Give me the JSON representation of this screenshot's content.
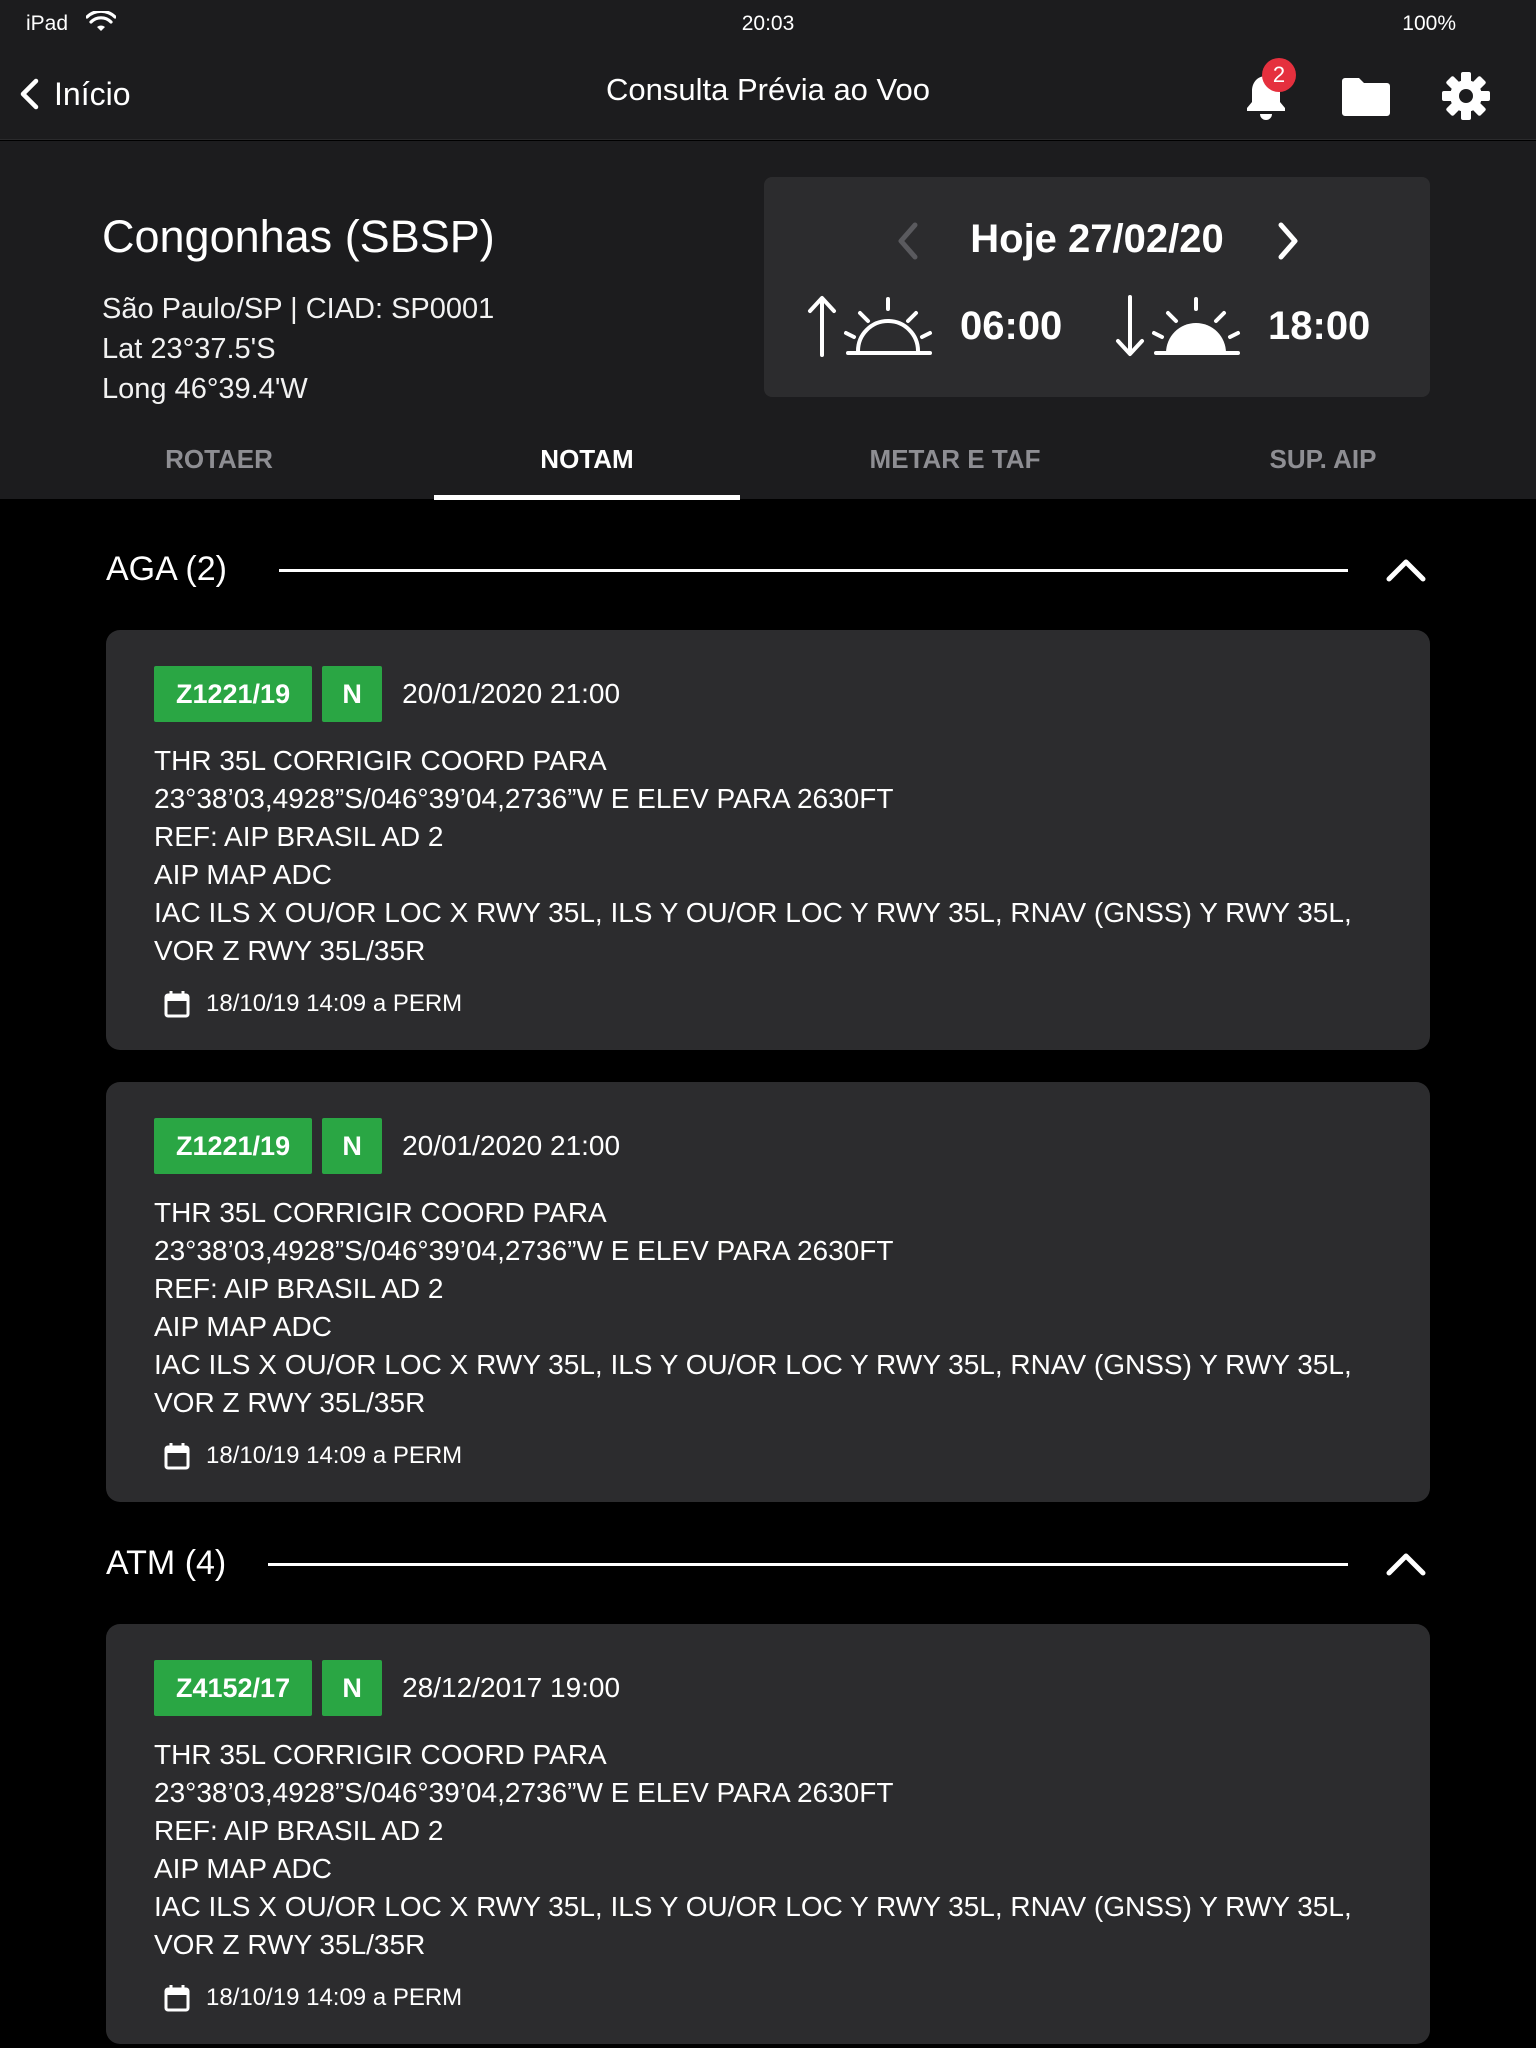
{
  "status_bar": {
    "device": "iPad",
    "time": "20:03",
    "battery": "100%"
  },
  "nav": {
    "back_label": "Início",
    "title": "Consulta Prévia ao Voo",
    "notification_count": "2"
  },
  "airport": {
    "name": "Congonhas (SBSP)",
    "city_ciad": "São Paulo/SP | CIAD: SP0001",
    "lat": "Lat 23°37.5'S",
    "long": "Long 46°39.4'W"
  },
  "date_card": {
    "label": "Hoje 27/02/20",
    "sunrise": "06:00",
    "sunset": "18:00"
  },
  "tabs": [
    {
      "label": "ROTAER"
    },
    {
      "label": "NOTAM"
    },
    {
      "label": "METAR E TAF"
    },
    {
      "label": "SUP. AIP"
    }
  ],
  "sections": [
    {
      "title": "AGA (2)",
      "cards": [
        {
          "id": "Z1221/19",
          "type": "N",
          "date": "20/01/2020 21:00",
          "text": "THR 35L CORRIGIR COORD PARA\n23°38’03,4928”S/046°39’04,2736”W E ELEV PARA 2630FT\nREF: AIP BRASIL AD 2\nAIP MAP ADC\nIAC ILS X OU/OR LOC X RWY 35L, ILS Y OU/OR LOC Y RWY 35L, RNAV (GNSS) Y RWY 35L, VOR Z RWY 35L/35R",
          "validity": "18/10/19 14:09 a PERM"
        },
        {
          "id": "Z1221/19",
          "type": "N",
          "date": "20/01/2020 21:00",
          "text": "THR 35L CORRIGIR COORD PARA\n23°38’03,4928”S/046°39’04,2736”W E ELEV PARA 2630FT\nREF: AIP BRASIL AD 2\nAIP MAP ADC\nIAC ILS X OU/OR LOC X RWY 35L, ILS Y OU/OR LOC Y RWY 35L, RNAV (GNSS) Y RWY 35L, VOR Z RWY 35L/35R",
          "validity": "18/10/19 14:09 a PERM"
        }
      ]
    },
    {
      "title": "ATM (4)",
      "cards": [
        {
          "id": "Z4152/17",
          "type": "N",
          "date": "28/12/2017 19:00",
          "text": "THR 35L CORRIGIR COORD PARA\n23°38’03,4928”S/046°39’04,2736”W E ELEV PARA 2630FT\nREF: AIP BRASIL AD 2\nAIP MAP ADC\nIAC ILS X OU/OR LOC X RWY 35L, ILS Y OU/OR LOC Y RWY 35L, RNAV (GNSS) Y RWY 35L, VOR Z RWY 35L/35R",
          "validity": "18/10/19 14:09 a PERM"
        }
      ]
    }
  ],
  "colors": {
    "notam_badge": "#2aa644",
    "notification_badge": "#e5303e",
    "panel": "#1c1c1e",
    "card": "#2c2c2e"
  },
  "icons": [
    "wifi-icon",
    "chevron-left-icon",
    "bell-icon",
    "folder-icon",
    "gear-icon",
    "chevron-right-icon",
    "sunrise-icon",
    "sunset-icon",
    "chevron-up-icon",
    "calendar-icon"
  ]
}
